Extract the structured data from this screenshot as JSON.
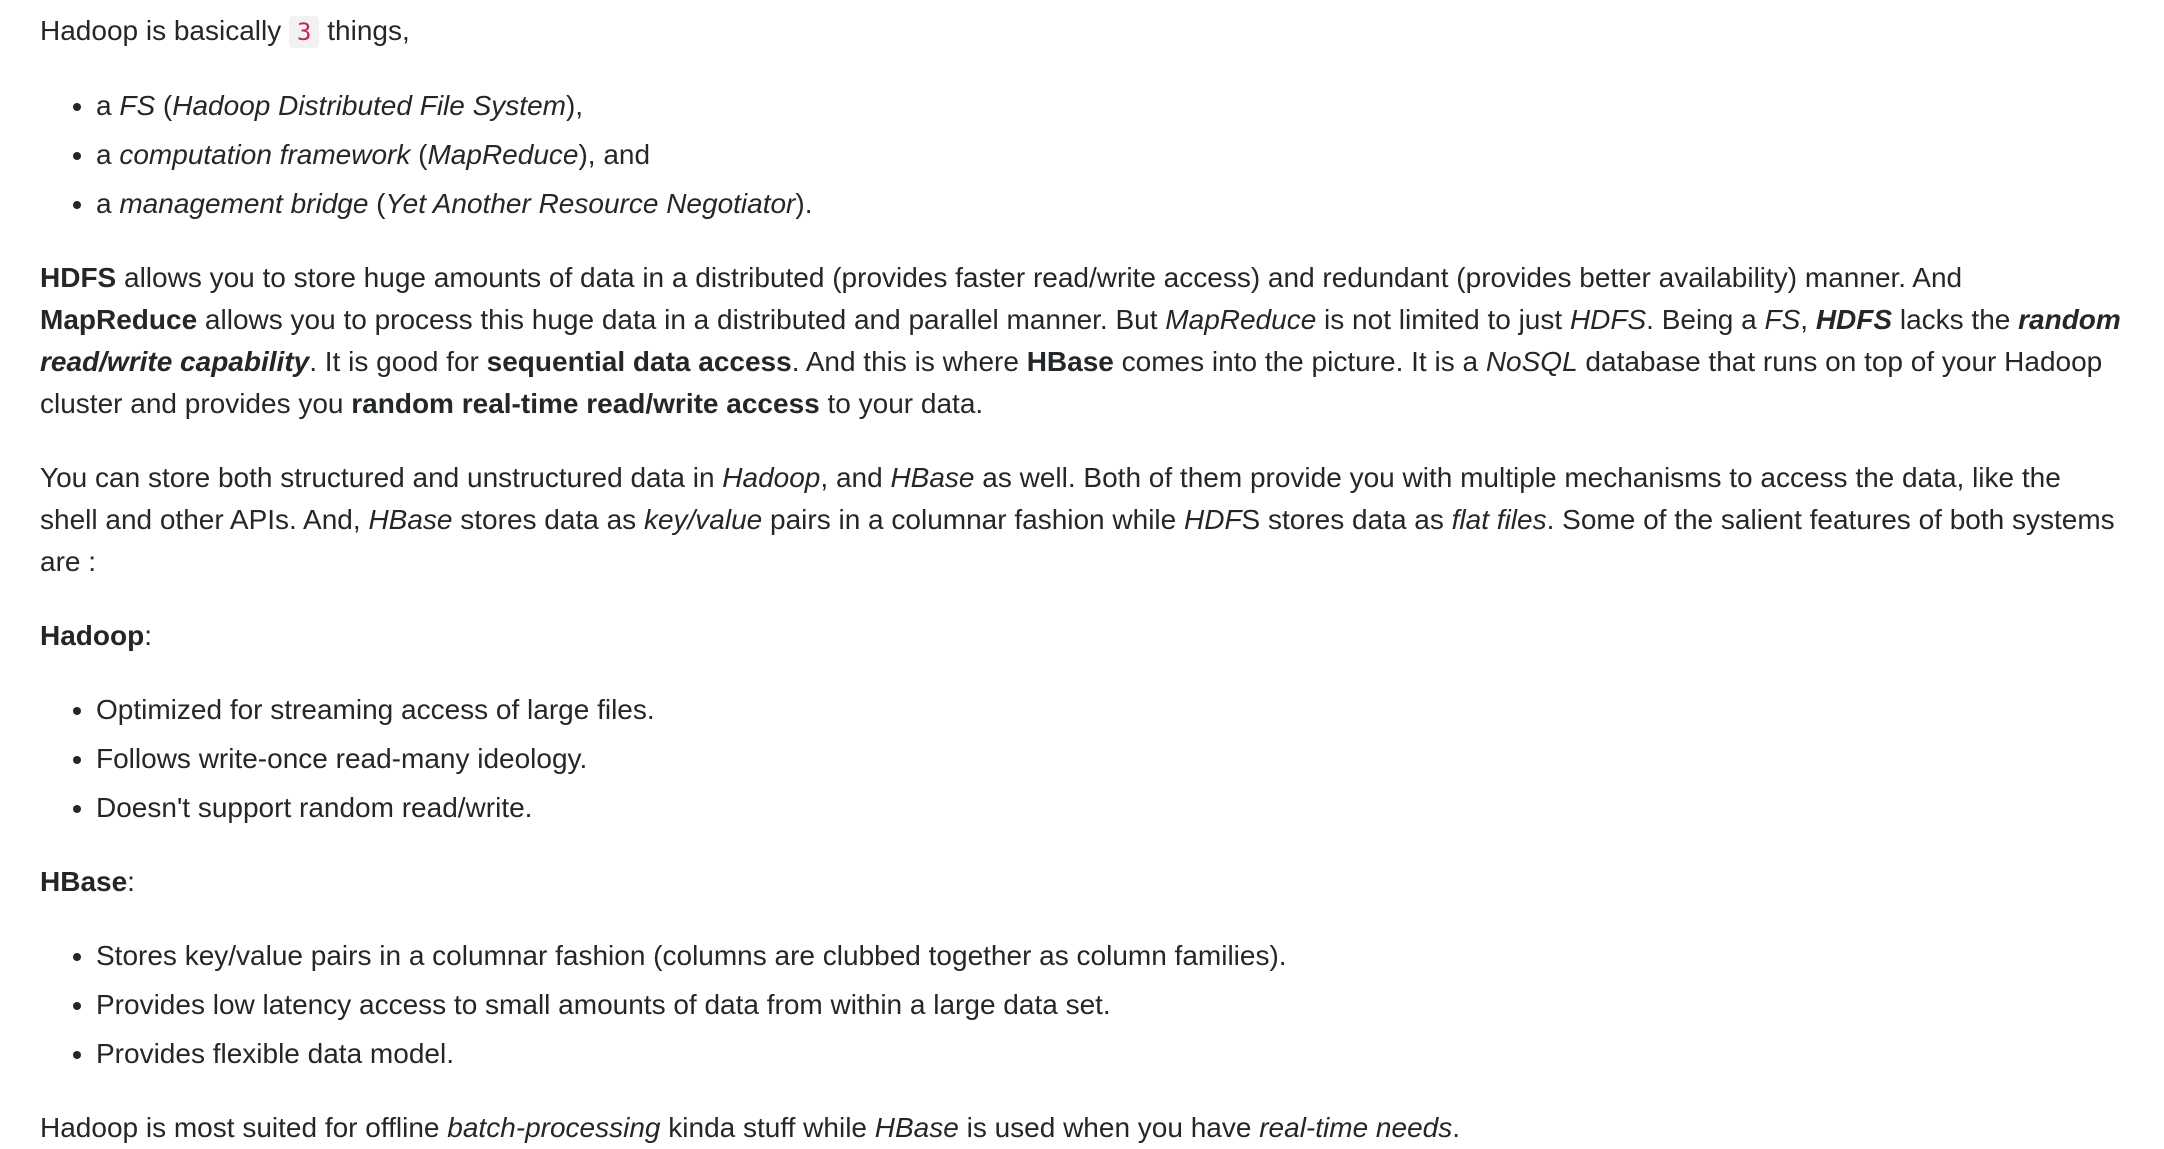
{
  "intro": {
    "prefix": "Hadoop is basically ",
    "count": "3",
    "suffix": " things,"
  },
  "things": [
    {
      "a": "a ",
      "em": "FS",
      "open": " (",
      "detail": "Hadoop Distributed File System",
      "close": "),"
    },
    {
      "a": "a ",
      "em": "computation framework",
      "open": " (",
      "detail": "MapReduce",
      "close": "), and"
    },
    {
      "a": "a ",
      "em": "management bridge",
      "open": " (",
      "detail": "Yet Another Resource Negotiator",
      "close": ")."
    }
  ],
  "para1": {
    "t1": "HDFS",
    "t2": " allows you to store huge amounts of data in a distributed (provides faster read/write access) and redundant (provides better availability) manner. And ",
    "t3": "MapReduce",
    "t4": " allows you to process this huge data in a distributed and parallel manner. But ",
    "t5": "MapReduce",
    "t6": " is not limited to just ",
    "t7": "HDFS",
    "t8": ". Being a ",
    "t9": "FS",
    "t10": ", ",
    "t11": "HDFS",
    "t12": " lacks the ",
    "t13": "random read/write capability",
    "t14": ". It is good for ",
    "t15": "sequential data access",
    "t16": ". And this is where ",
    "t17": "HBase",
    "t18": " comes into the picture. It is a ",
    "t19": "NoSQL",
    "t20": " database that runs on top of your Hadoop cluster and provides you ",
    "t21": "random real-time read/write access",
    "t22": " to your data."
  },
  "para2": {
    "t1": "You can store both structured and unstructured data in ",
    "t2": "Hadoop",
    "t3": ", and ",
    "t4": "HBase",
    "t5": " as well. Both of them provide you with multiple mechanisms to access the data, like the shell and other APIs. And, ",
    "t6": "HBase",
    "t7": " stores data as ",
    "t8": "key/value",
    "t9": " pairs in a columnar fashion while ",
    "t10": "HDF",
    "t11": "S stores data as ",
    "t12": "flat files",
    "t13": ". Some of the salient features of both systems are :"
  },
  "hadoop": {
    "heading": "Hadoop",
    "colon": ":",
    "items": [
      "Optimized for streaming access of large files.",
      "Follows write-once read-many ideology.",
      "Doesn't support random read/write."
    ]
  },
  "hbase": {
    "heading": "HBase",
    "colon": ":",
    "items": [
      "Stores key/value pairs in a columnar fashion (columns are clubbed together as column families).",
      "Provides low latency access to small amounts of data from within a large data set.",
      "Provides flexible data model."
    ]
  },
  "conclusion": {
    "t1": "Hadoop is most suited for offline ",
    "t2": "batch-processing",
    "t3": " kinda stuff while ",
    "t4": "HBase",
    "t5": " is used when you have ",
    "t6": "real-time needs",
    "t7": "."
  }
}
